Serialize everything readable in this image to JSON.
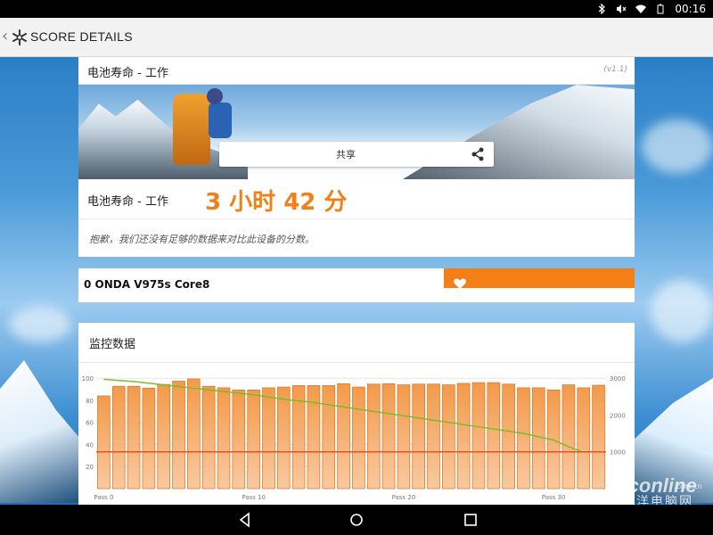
{
  "status_bar": {
    "time": "00:16",
    "icons": [
      "bluetooth-icon",
      "mute-icon",
      "wifi-icon",
      "battery-icon"
    ]
  },
  "action_bar": {
    "back_glyph": "‹",
    "title": "SCORE DETAILS",
    "app_icon": "snowflake-icon"
  },
  "result_card": {
    "header_title": "电池寿命 - 工作",
    "version": "(v1.1)",
    "share_label": "共享",
    "score_label": "电池寿命 - 工作",
    "score_value": "3 小时 42 分",
    "note": "抱歉，我们还没有足够的数据来对比此设备的分数。",
    "accent_color": "#f47f16"
  },
  "device_card": {
    "device_name": "0 ONDA V975s Core8",
    "bar_color": "#f47f16",
    "icon": "heart-icon"
  },
  "monitor_card": {
    "title": "监控数据"
  },
  "chart_data": {
    "type": "bar",
    "title": "",
    "x_tick_labels": [
      "Pass 0",
      "Pass 10",
      "Pass 20",
      "Pass 30"
    ],
    "x_tick_positions": [
      0,
      10,
      20,
      30
    ],
    "left_axis_ticks": [
      "100",
      "80",
      "60",
      "40",
      "20"
    ],
    "left_axis_values": [
      100,
      80,
      60,
      40,
      20
    ],
    "right_axis_ticks": [
      "3000",
      "2000",
      "1000"
    ],
    "right_axis_values": [
      3000,
      2000,
      1000
    ],
    "ylim_left": [
      0,
      105
    ],
    "ylim_right": [
      0,
      3150
    ],
    "bar_series": {
      "name": "",
      "color": "#f5a05a",
      "values": [
        2520,
        2780,
        2780,
        2730,
        2830,
        2920,
        2980,
        2780,
        2740,
        2680,
        2680,
        2740,
        2760,
        2800,
        2800,
        2800,
        2850,
        2760,
        2840,
        2850,
        2820,
        2840,
        2840,
        2820,
        2860,
        2880,
        2880,
        2840,
        2740,
        2740,
        2680,
        2820,
        2740,
        2810
      ]
    },
    "battery_series": {
      "name": "",
      "color": "#7dbb2a",
      "points": [
        [
          0,
          99
        ],
        [
          2,
          97
        ],
        [
          4,
          94
        ],
        [
          6,
          91
        ],
        [
          8,
          88
        ],
        [
          10,
          85
        ],
        [
          12,
          81
        ],
        [
          14,
          78
        ],
        [
          16,
          74
        ],
        [
          18,
          70
        ],
        [
          20,
          66
        ],
        [
          22,
          62
        ],
        [
          24,
          58
        ],
        [
          26,
          54
        ],
        [
          28,
          50
        ],
        [
          30,
          44
        ],
        [
          31,
          38
        ],
        [
          31.8,
          34
        ]
      ]
    },
    "threshold_series": {
      "name": "",
      "color": "#e0522a",
      "value": 1000
    }
  },
  "nav_bar": {
    "buttons": [
      "back-icon",
      "home-icon",
      "recents-icon"
    ]
  },
  "watermark": {
    "brand": "Pconline",
    "suffix": ".com.cn",
    "chinese": "太平洋电脑网"
  }
}
